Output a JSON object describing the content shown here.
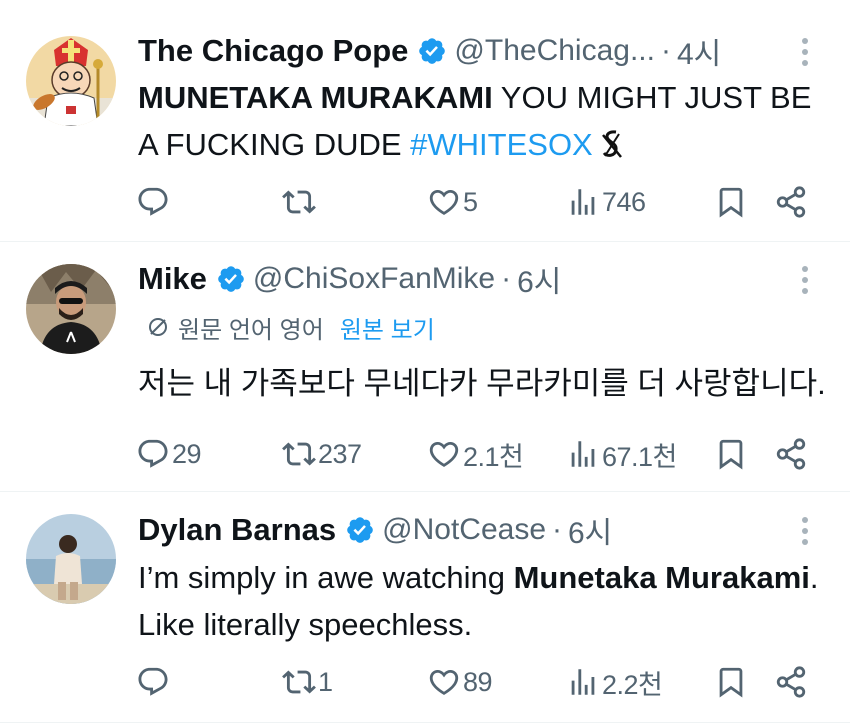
{
  "tweets": [
    {
      "name": "The Chicago Pope",
      "handle": "@TheChicag...",
      "dot": "·",
      "time": "4시",
      "text_bold": "MUNETAKA MURAKAMI",
      "text_rest": " YOU MIGHT JUST BE A FUCKING DUDE ",
      "hashtag": "#WHITESOX",
      "stats": {
        "replies": "",
        "reposts": "",
        "likes": "5",
        "views": "746"
      }
    },
    {
      "name": "Mike",
      "handle": "@ChiSoxFanMike",
      "dot": "·",
      "time": "6시",
      "translation_label": "원문 언어 영어",
      "translation_action": "원본 보기",
      "text": "저는 내 가족보다 무네다카 무라카미를 더 사랑합니다.",
      "stats": {
        "replies": "29",
        "reposts": "237",
        "likes": "2.1천",
        "views": "67.1천"
      }
    },
    {
      "name": "Dylan Barnas",
      "handle": "@NotCease",
      "dot": "·",
      "time": "6시",
      "text_pre": "I’m simply in awe watching ",
      "text_bold": "Munetaka Murakami",
      "text_post": ". Like literally speechless.",
      "stats": {
        "replies": "",
        "reposts": "1",
        "likes": "89",
        "views": "2.2천"
      }
    }
  ],
  "icons": [
    "reply-icon",
    "repost-icon",
    "like-icon",
    "views-icon",
    "bookmark-icon",
    "share-icon",
    "more-icon",
    "verified-icon",
    "translate-icon",
    "white-sox-logo"
  ],
  "colors": {
    "accent": "#1d9bf0",
    "text": "#0f1419",
    "secondary": "#536471",
    "divider": "#eff3f4"
  }
}
